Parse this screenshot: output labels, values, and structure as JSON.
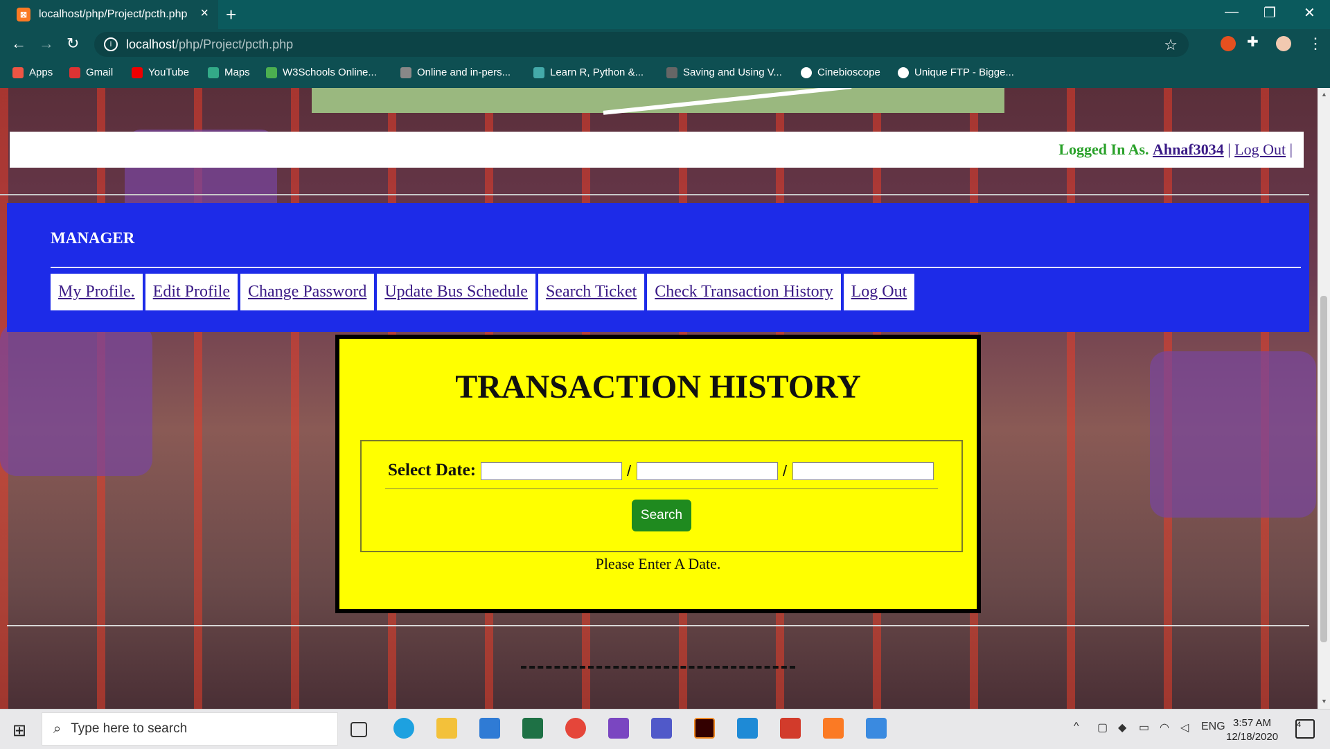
{
  "browser": {
    "tab_title": "localhost/php/Project/pcth.php",
    "url_host": "localhost",
    "url_path": "/php/Project/pcth.php",
    "bookmarks": [
      {
        "label": "Apps",
        "icon": "apps-grid-icon",
        "color": "#e54"
      },
      {
        "label": "Gmail",
        "icon": "gmail-icon",
        "color": "#d33"
      },
      {
        "label": "YouTube",
        "icon": "youtube-icon",
        "color": "#e00"
      },
      {
        "label": "Maps",
        "icon": "maps-icon",
        "color": "#3a8"
      },
      {
        "label": "W3Schools Online...",
        "icon": "w3schools-icon",
        "color": "#4caf50"
      },
      {
        "label": "Online and in-pers...",
        "icon": "site-icon",
        "color": "#888"
      },
      {
        "label": "Learn R, Python &...",
        "icon": "shield-icon",
        "color": "#4aa"
      },
      {
        "label": "Saving and Using V...",
        "icon": "site-icon",
        "color": "#666"
      },
      {
        "label": "Cinebioscope",
        "icon": "globe-icon",
        "color": "#fff"
      },
      {
        "label": "Unique FTP - Bigge...",
        "icon": "globe-icon",
        "color": "#fff"
      }
    ]
  },
  "header": {
    "logged_in_label": "Logged In As.",
    "username": "Ahnaf3034",
    "separator1": "|",
    "logout_label": "Log Out",
    "separator2": "|"
  },
  "panel": {
    "role": "MANAGER",
    "menu": [
      "My Profile.",
      "Edit Profile",
      "Change Password",
      "Update Bus Schedule",
      "Search Ticket",
      "Check Transaction History",
      "Log Out"
    ]
  },
  "main": {
    "title": "TRANSACTION HISTORY",
    "date_label": "Select Date:",
    "date_separator": "/",
    "day_value": "",
    "month_value": "",
    "year_value": "",
    "search_button": "Search",
    "message": "Please Enter A Date."
  },
  "taskbar": {
    "search_placeholder": "Type here to search",
    "language": "ENG",
    "time": "3:57 AM",
    "date": "12/18/2020",
    "notification_count": "4"
  },
  "colors": {
    "panel_bg": "#1d2be8",
    "card_bg": "#ffff00",
    "search_button": "#1f8a1f",
    "logged_in_label": "#2aa12a",
    "link": "#3a1a86"
  }
}
